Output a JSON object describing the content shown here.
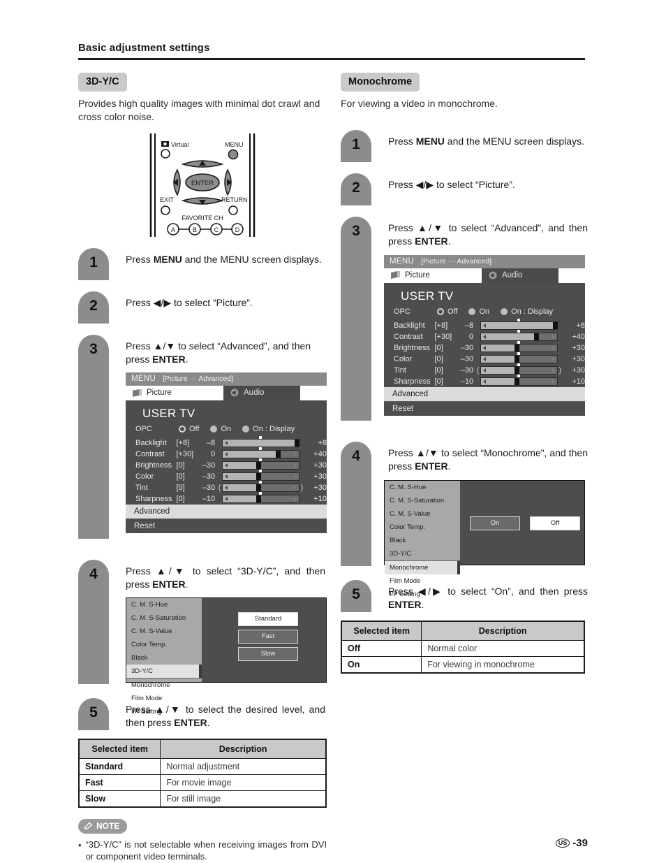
{
  "page": {
    "header_title": "Basic adjustment settings",
    "footer_region": "US",
    "footer_page": "-39"
  },
  "left": {
    "chip": "3D-Y/C",
    "lead": "Provides high quality images with minimal dot crawl and cross color noise.",
    "steps": [
      {
        "num": "1",
        "text_html": "Press <b>MENU</b> and the MENU screen displays."
      },
      {
        "num": "2",
        "text_html": "Press ◀/▶ to select “Picture”."
      },
      {
        "num": "3",
        "text_html": "Press ▲/▼ to select “Advanced”, and then press <b>ENTER</b>."
      },
      {
        "num": "4",
        "text_html": "Press ▲/▼ to select “3D-Y/C”, and then press <b>ENTER</b>."
      },
      {
        "num": "5",
        "text_html": "Press ▲/▼ to select the desired level, and then press <b>ENTER</b>."
      }
    ],
    "submenu_selected": "3D-Y/C",
    "options": [
      {
        "label": "Standard",
        "state": "on"
      },
      {
        "label": "Fast",
        "state": "off"
      },
      {
        "label": "Slow",
        "state": "off"
      }
    ],
    "table": {
      "headers": [
        "Selected item",
        "Description"
      ],
      "rows": [
        {
          "item": "Standard",
          "desc": "Normal adjustment"
        },
        {
          "item": "Fast",
          "desc": "For movie image"
        },
        {
          "item": "Slow",
          "desc": "For still image"
        }
      ]
    },
    "note": {
      "label": "NOTE",
      "items": [
        "“3D-Y/C” is not selectable when receiving images from DVI or component video terminals."
      ]
    }
  },
  "right": {
    "chip": "Monochrome",
    "lead": "For viewing a video in monochrome.",
    "steps": [
      {
        "num": "1",
        "text_html": "Press <b>MENU</b> and the MENU screen displays."
      },
      {
        "num": "2",
        "text_html": "Press ◀/▶ to select “Picture”."
      },
      {
        "num": "3",
        "text_html": "Press ▲/▼ to select “Advanced”, and then press <b>ENTER</b>."
      },
      {
        "num": "4",
        "text_html": "Press ▲/▼ to select “Monochrome”, and then press <b>ENTER</b>."
      },
      {
        "num": "5",
        "text_html": "Press ◀/▶ to select “On”, and then press <b>ENTER</b>."
      }
    ],
    "submenu_selected": "Monochrome",
    "options": [
      {
        "label": "On",
        "state": "off"
      },
      {
        "label": "Off",
        "state": "on"
      }
    ],
    "table": {
      "headers": [
        "Selected item",
        "Description"
      ],
      "rows": [
        {
          "item": "Off",
          "desc": "Normal color"
        },
        {
          "item": "On",
          "desc": "For viewing in monochrome"
        }
      ]
    }
  },
  "osd": {
    "menu_title": "MENU",
    "menu_path": "[Picture ··· Advanced]",
    "tabs": [
      {
        "label": "Picture",
        "icon": "picture-icon",
        "active": true
      },
      {
        "label": "Audio",
        "icon": "speaker-icon",
        "active": false
      }
    ],
    "panel_title": "USER TV",
    "opc": {
      "label": "OPC",
      "choices": [
        {
          "label": "Off",
          "selected": true
        },
        {
          "label": "On",
          "selected": false
        },
        {
          "label": "On : Display",
          "selected": false
        }
      ]
    },
    "sliders": [
      {
        "name": "Backlight",
        "current": "[+8]",
        "lo": "–8",
        "hi": "+8",
        "fill_pct": 100,
        "thumb_pct": 100,
        "paren": false,
        "caps": "left"
      },
      {
        "name": "Contrast",
        "current": "[+30]",
        "lo": "0",
        "hi": "+40",
        "fill_pct": 75,
        "thumb_pct": 75,
        "paren": false,
        "caps": "both"
      },
      {
        "name": "Brightness",
        "current": "[0]",
        "lo": "–30",
        "hi": "+30",
        "fill_pct": 50,
        "thumb_pct": 50,
        "paren": false,
        "caps": "both"
      },
      {
        "name": "Color",
        "current": "[0]",
        "lo": "–30",
        "hi": "+30",
        "fill_pct": 50,
        "thumb_pct": 50,
        "paren": false,
        "caps": "both"
      },
      {
        "name": "Tint",
        "current": "[0]",
        "lo": "–30",
        "hi": "+30",
        "fill_pct": 50,
        "thumb_pct": 50,
        "paren": true,
        "caps": "both"
      },
      {
        "name": "Sharpness",
        "current": "[0]",
        "lo": "–10",
        "hi": "+10",
        "fill_pct": 50,
        "thumb_pct": 50,
        "paren": false,
        "caps": "both"
      }
    ],
    "list_rows": [
      {
        "label": "Advanced",
        "highlight": true
      },
      {
        "label": "Reset",
        "highlight": false
      }
    ],
    "submenu_items": [
      "C. M. S-Hue",
      "C. M. S-Saturation",
      "C. M. S-Value",
      "Color Temp.",
      "Black",
      "3D-Y/C",
      "Monochrome",
      "Film Mode",
      "I/P Setting"
    ]
  },
  "remote": {
    "virtual_label": "Virtual",
    "menu_label": "MENU",
    "enter_label": "ENTER",
    "exit_label": "EXIT",
    "return_label": "RETURN",
    "favorite_label": "FAVORITE CH",
    "color_buttons": [
      "A",
      "B",
      "C",
      "D"
    ]
  }
}
